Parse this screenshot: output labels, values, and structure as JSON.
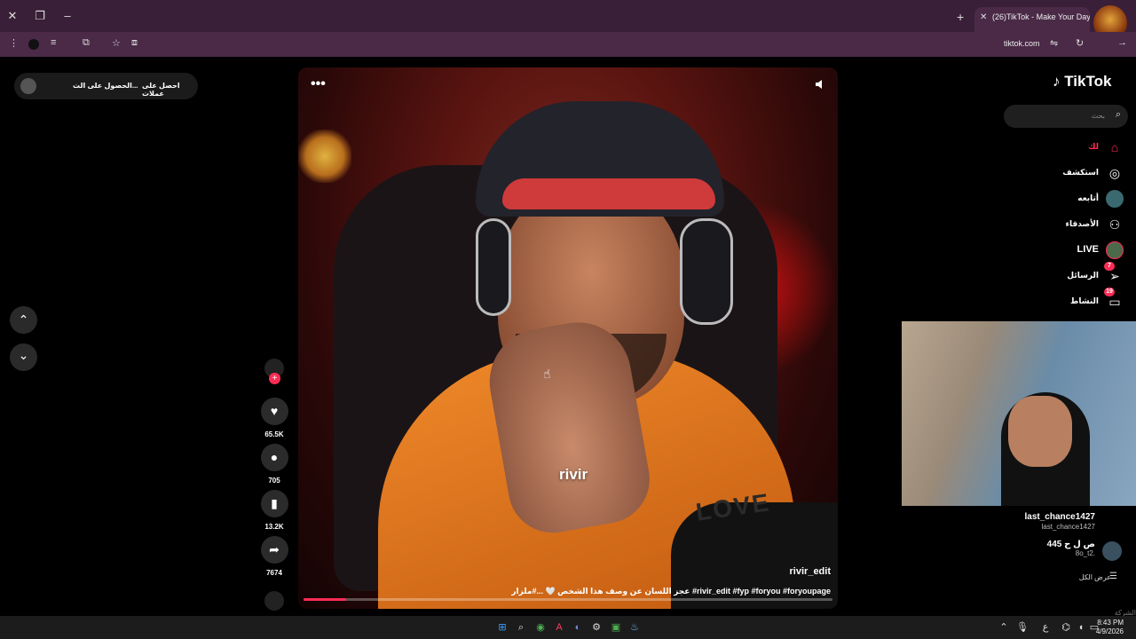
{
  "browser": {
    "tab_title": "(26)TikTok - Make Your Day",
    "url": "tiktok.com"
  },
  "promo": {
    "get_coins": "احصل على عملات",
    "get_app": "الحصول على الت..."
  },
  "video": {
    "watermark": "rivir",
    "more": "•••",
    "author": "rivir_edit",
    "caption": "عجز اللسان عن وصف هذا الشخص 🤍 ...#ملزار #rivir_edit #fyp #foryou #foryoupage",
    "progress": 0.08
  },
  "actions": {
    "likes": "65.5K",
    "comments": "705",
    "saves": "13.2K",
    "shares": "7674"
  },
  "sidebar": {
    "logo": "TikTok",
    "search_placeholder": "بحث",
    "items": [
      {
        "label": "لك",
        "icon": "home-icon",
        "active": true
      },
      {
        "label": "استكشف",
        "icon": "explore-icon"
      },
      {
        "label": "أتابعه",
        "icon": "following-icon"
      },
      {
        "label": "الأصدقاء",
        "icon": "friends-icon"
      },
      {
        "label": "LIVE",
        "icon": "live-icon"
      },
      {
        "label": "الرسائل",
        "icon": "messages-icon",
        "badge": "7"
      },
      {
        "label": "النشاط",
        "icon": "activity-icon",
        "badge": "19"
      }
    ],
    "accounts": [
      {
        "name": "last_chance1427",
        "user": "last_chance1427"
      },
      {
        "name": "ص ل ح 445",
        "user": "8o_t2."
      }
    ],
    "show_all": "عرض الكل",
    "company": "الشركة"
  },
  "taskbar": {
    "time": "8:43 PM",
    "date": "4/9/2026",
    "lang": "ع"
  },
  "colors": {
    "accent": "#fe2c55",
    "chrome": "#3a1f38"
  }
}
